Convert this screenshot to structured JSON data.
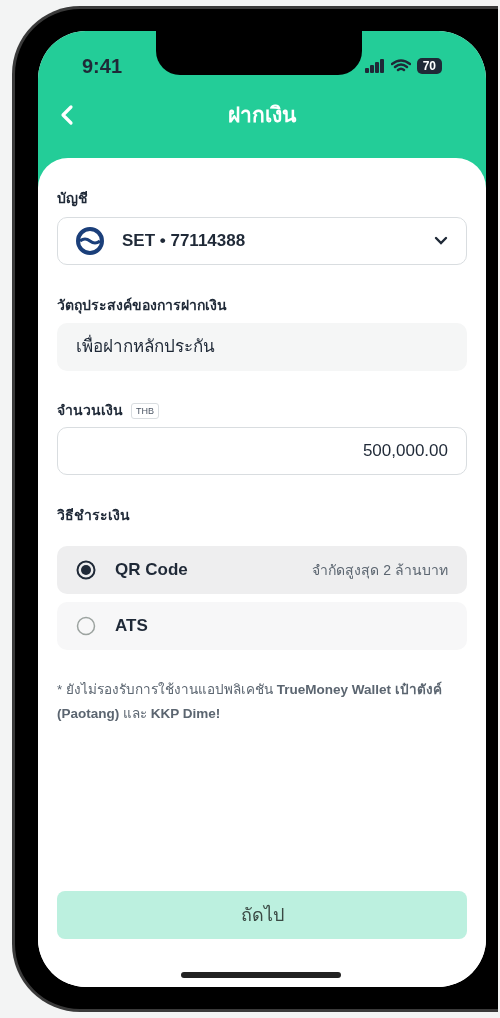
{
  "status_bar": {
    "time": "9:41",
    "battery": "70"
  },
  "header": {
    "title": "ฝากเงิน"
  },
  "account": {
    "label": "บัญชี",
    "value": "SET • 77114388"
  },
  "purpose": {
    "label": "วัตถุประสงค์ของการฝากเงิน",
    "value": "เพื่อฝากหลักประกัน"
  },
  "amount": {
    "label": "จำนวนเงิน",
    "currency": "THB",
    "value": "500,000.00"
  },
  "payment": {
    "label": "วิธีชำระเงิน",
    "options": [
      {
        "name": "QR Code",
        "note": "จำกัดสูงสุด 2 ล้านบาท",
        "selected": true
      },
      {
        "name": "ATS",
        "selected": false
      }
    ]
  },
  "footnote": "* ยังไม่รองรับการใช้งานแอปพลิเคชัน **TrueMoney Wallet เป๋าตังค์ (Paotang)** และ **KKP Dime!**",
  "next_button": {
    "label": "ถัดไป",
    "disabled": true
  }
}
